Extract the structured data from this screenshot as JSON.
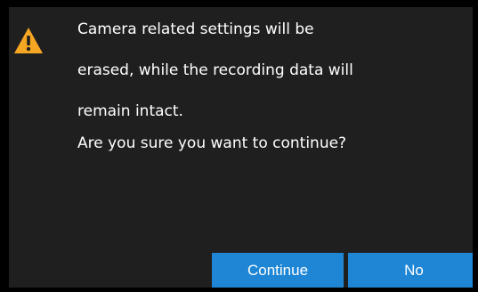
{
  "dialog": {
    "icon": "warning-icon",
    "icon_color": "#f5a623",
    "accent_color": "#1f86d6",
    "message_lines": [
      "Camera related settings will be",
      "erased, while the recording data will",
      "remain intact."
    ],
    "question": "Are you sure you want to continue?",
    "continue_label": "Continue",
    "no_label": "No"
  }
}
